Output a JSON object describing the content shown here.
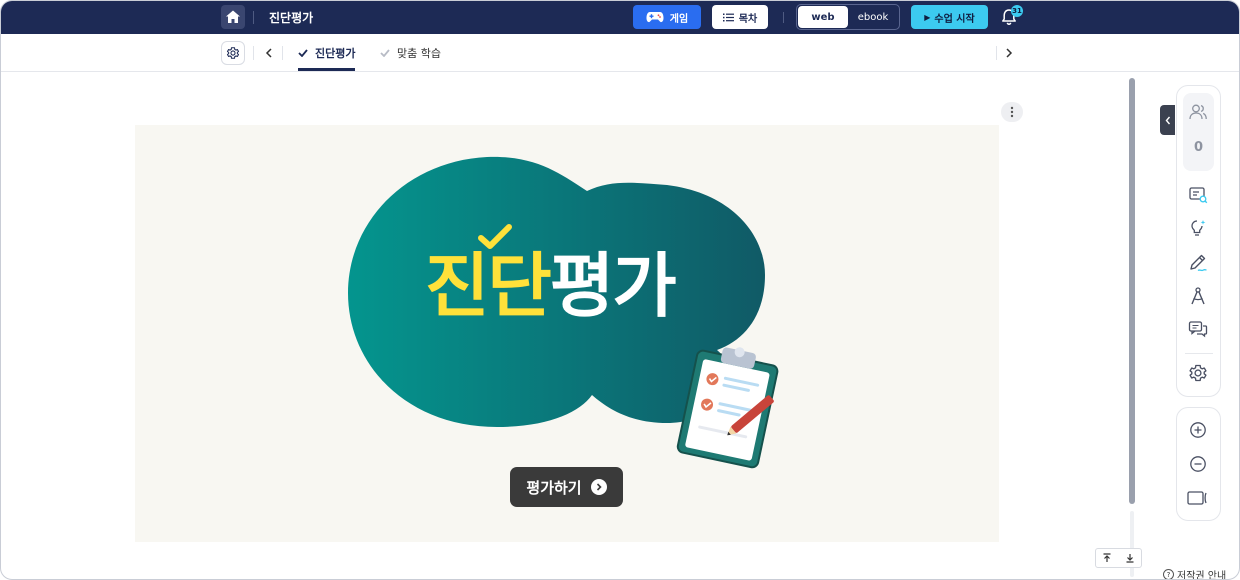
{
  "header": {
    "title": "진단평가",
    "game_label": "게임",
    "toc_label": "목차",
    "view_modes": [
      "web",
      "ebook"
    ],
    "selected_view": "web",
    "start_label": "수업 시작",
    "notification_count": "31"
  },
  "tabs": [
    {
      "label": "진단평가",
      "active": true
    },
    {
      "label": "맞춤 학습",
      "active": false
    }
  ],
  "banner": {
    "title_highlight": "진단",
    "title_rest": "평가",
    "button_label": "평가하기"
  },
  "sidebar": {
    "participant_count": "0",
    "tools": [
      "screen-search-icon",
      "idea-bulb-icon",
      "pen-icon",
      "compass-icon",
      "chat-icon",
      "settings-icon"
    ],
    "zoom_tools": [
      "zoom-in-icon",
      "zoom-out-icon",
      "fit-screen-icon"
    ]
  },
  "footer": {
    "copyright_label": "저작권 안내"
  },
  "colors": {
    "header_bg": "#1d2a55",
    "game_button": "#2a6df0",
    "start_button": "#3ccaf0",
    "banner_teal": "#0e8f8a",
    "banner_yellow": "#ffe13a"
  }
}
